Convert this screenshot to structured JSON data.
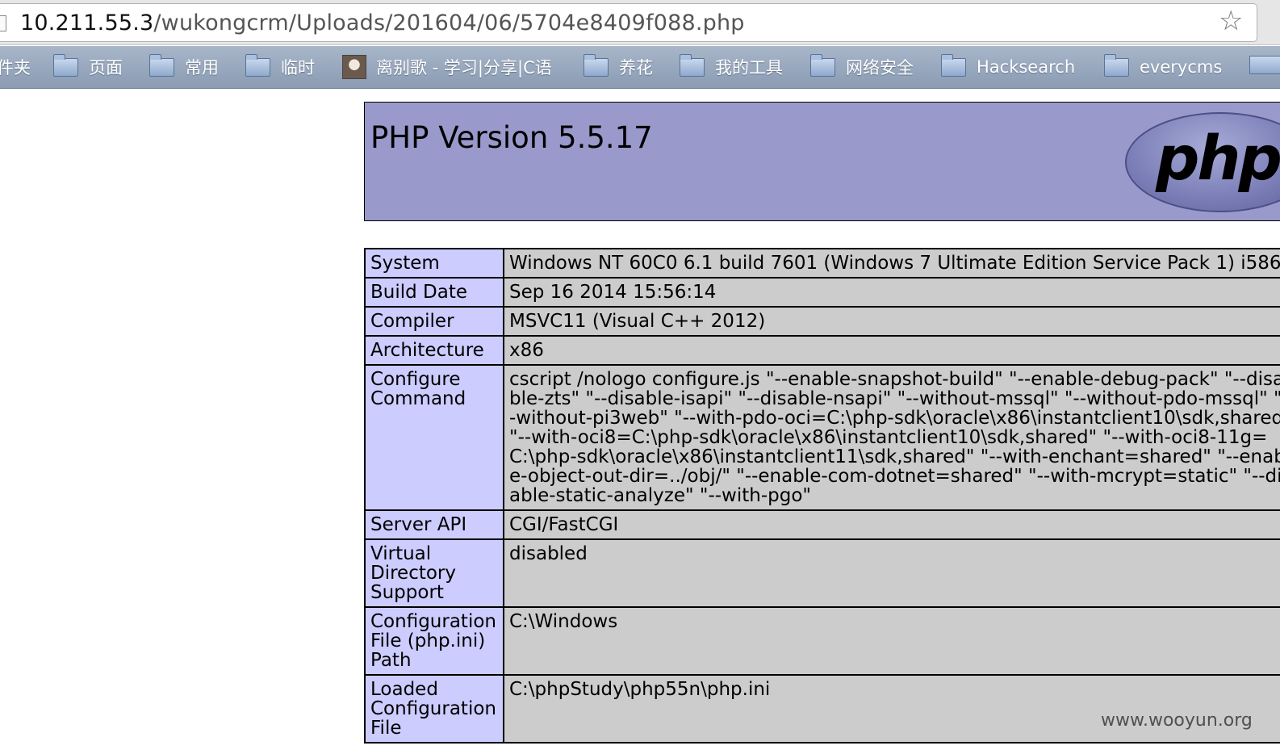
{
  "address_bar": {
    "host": "10.211.55.3",
    "path": "/wukongcrm/Uploads/201604/06/5704e8409f088.php",
    "bookmark_star_icon": "star-icon"
  },
  "bookmarks": [
    {
      "label": "件夹",
      "icon": "none"
    },
    {
      "label": "页面",
      "icon": "folder-icon"
    },
    {
      "label": "常用",
      "icon": "folder-icon"
    },
    {
      "label": "临时",
      "icon": "folder-icon"
    },
    {
      "label": "离别歌 - 学习|分享|C语",
      "icon": "site-favicon"
    },
    {
      "label": "养花",
      "icon": "folder-icon"
    },
    {
      "label": "我的工具",
      "icon": "folder-icon"
    },
    {
      "label": "网络安全",
      "icon": "folder-icon"
    },
    {
      "label": "Hacksearch",
      "icon": "folder-icon"
    },
    {
      "label": "everycms",
      "icon": "folder-icon"
    }
  ],
  "php_header": {
    "title": "PHP Version 5.5.17",
    "logo_text": "php",
    "bg_color": "#9999cc"
  },
  "info_rows": [
    {
      "key": "System",
      "value": "Windows NT 60C0 6.1 build 7601 (Windows 7 Ultimate Edition Service Pack 1) i586"
    },
    {
      "key": "Build Date",
      "value": "Sep 16 2014 15:56:14"
    },
    {
      "key": "Compiler",
      "value": "MSVC11 (Visual C++ 2012)"
    },
    {
      "key": "Architecture",
      "value": "x86"
    },
    {
      "key": "Configure Command",
      "value": "cscript /nologo configure.js \"--enable-snapshot-build\" \"--enable-debug-pack\" \"--disable-zts\" \"--disable-isapi\" \"--disable-nsapi\" \"--without-mssql\" \"--without-pdo-mssql\" \"--without-pi3web\" \"--with-pdo-oci=C:\\php-sdk\\oracle\\x86\\instantclient10\\sdk,shared\" \"--with-oci8=C:\\php-sdk\\oracle\\x86\\instantclient10\\sdk,shared\" \"--with-oci8-11g=C:\\php-sdk\\oracle\\x86\\instantclient11\\sdk,shared\" \"--with-enchant=shared\" \"--enable-object-out-dir=../obj/\" \"--enable-com-dotnet=shared\" \"--with-mcrypt=static\" \"--disable-static-analyze\" \"--with-pgo\""
    },
    {
      "key": "Server API",
      "value": "CGI/FastCGI"
    },
    {
      "key": "Virtual Directory Support",
      "value": "disabled"
    },
    {
      "key": "Configuration File (php.ini) Path",
      "value": "C:\\Windows"
    },
    {
      "key": "Loaded Configuration File",
      "value": "C:\\phpStudy\\php55n\\php.ini"
    }
  ],
  "watermark": "www.wooyun.org",
  "colors": {
    "key_cell": "#ccccff",
    "value_cell": "#cccccc"
  }
}
